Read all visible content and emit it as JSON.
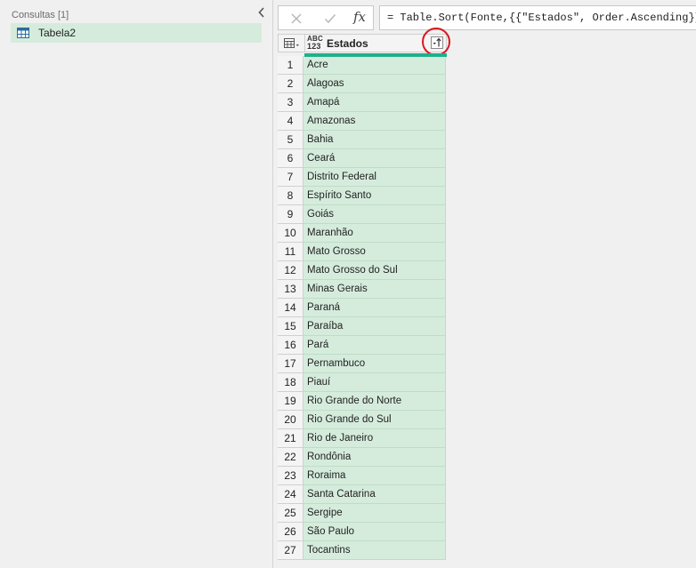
{
  "queries": {
    "header": "Consultas [1]",
    "items": [
      {
        "label": "Tabela2",
        "icon": "table-icon"
      }
    ]
  },
  "formula_bar": {
    "cancel_icon": "close-icon",
    "confirm_icon": "check-icon",
    "fx_label": "fx",
    "formula": "= Table.Sort(Fonte,{{\"Estados\", Order.Ascending}})"
  },
  "grid": {
    "column": {
      "type_top": "ABC",
      "type_bottom": "123",
      "name": "Estados",
      "filter_icon": "sort-ascending-filter-icon"
    },
    "rows": [
      {
        "n": "1",
        "value": "Acre"
      },
      {
        "n": "2",
        "value": "Alagoas"
      },
      {
        "n": "3",
        "value": "Amapá"
      },
      {
        "n": "4",
        "value": "Amazonas"
      },
      {
        "n": "5",
        "value": "Bahia"
      },
      {
        "n": "6",
        "value": "Ceará"
      },
      {
        "n": "7",
        "value": "Distrito Federal"
      },
      {
        "n": "8",
        "value": "Espírito Santo"
      },
      {
        "n": "9",
        "value": "Goiás"
      },
      {
        "n": "10",
        "value": "Maranhão"
      },
      {
        "n": "11",
        "value": "Mato Grosso"
      },
      {
        "n": "12",
        "value": "Mato Grosso do Sul"
      },
      {
        "n": "13",
        "value": "Minas Gerais"
      },
      {
        "n": "14",
        "value": "Paraná"
      },
      {
        "n": "15",
        "value": "Paraíba"
      },
      {
        "n": "16",
        "value": "Pará"
      },
      {
        "n": "17",
        "value": "Pernambuco"
      },
      {
        "n": "18",
        "value": "Piauí"
      },
      {
        "n": "19",
        "value": "Rio Grande do Norte"
      },
      {
        "n": "20",
        "value": "Rio Grande do Sul"
      },
      {
        "n": "21",
        "value": "Rio de Janeiro"
      },
      {
        "n": "22",
        "value": "Rondônia"
      },
      {
        "n": "23",
        "value": "Roraima"
      },
      {
        "n": "24",
        "value": "Santa Catarina"
      },
      {
        "n": "25",
        "value": "Sergipe"
      },
      {
        "n": "26",
        "value": "São Paulo"
      },
      {
        "n": "27",
        "value": "Tocantins"
      }
    ]
  },
  "colors": {
    "selected": "#d5ecdd",
    "quality_bar": "#1fb08b",
    "highlight": "#d8181f"
  }
}
